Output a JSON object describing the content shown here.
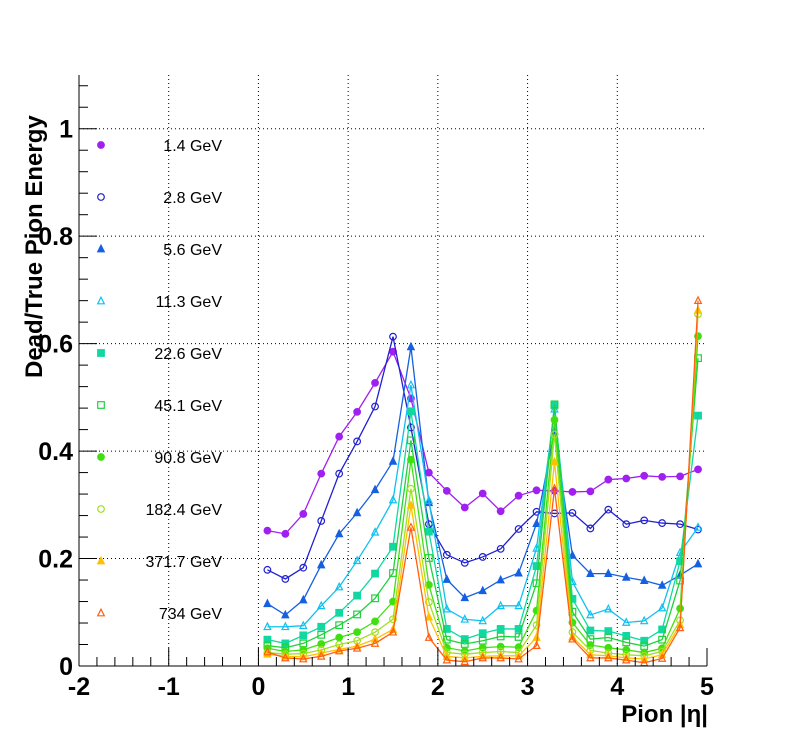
{
  "chart_data": {
    "type": "line",
    "xlabel": "Pion |η|",
    "ylabel": "Dead/True Pion Energy",
    "xlim": [
      -2,
      5
    ],
    "ylim": [
      0,
      1.1
    ],
    "x_ticks": [
      "-2",
      "-1",
      "0",
      "1",
      "2",
      "3",
      "4",
      "5"
    ],
    "y_ticks": [
      "0",
      "0.2",
      "0.4",
      "0.6",
      "0.8",
      "1"
    ],
    "grid": true,
    "legend_position": "left",
    "x": [
      0.1,
      0.3,
      0.5,
      0.7,
      0.9,
      1.1,
      1.3,
      1.5,
      1.7,
      1.9,
      2.1,
      2.3,
      2.5,
      2.7,
      2.9,
      3.1,
      3.3,
      3.5,
      3.7,
      3.9,
      4.1,
      4.3,
      4.5,
      4.7,
      4.9
    ],
    "series": [
      {
        "name": "1.4 GeV",
        "color": "#a020f0",
        "marker": "circle",
        "filled": true,
        "values": [
          0.252,
          0.246,
          0.283,
          0.358,
          0.427,
          0.473,
          0.527,
          0.585,
          0.498,
          0.36,
          0.326,
          0.295,
          0.321,
          0.288,
          0.317,
          0.327,
          0.326,
          0.324,
          0.325,
          0.347,
          0.349,
          0.354,
          0.352,
          0.353,
          0.366
        ]
      },
      {
        "name": "2.8 GeV",
        "color": "#2020d0",
        "marker": "circle",
        "filled": false,
        "values": [
          0.179,
          0.162,
          0.183,
          0.27,
          0.358,
          0.418,
          0.483,
          0.613,
          0.444,
          0.264,
          0.207,
          0.192,
          0.203,
          0.218,
          0.255,
          0.287,
          0.284,
          0.285,
          0.256,
          0.291,
          0.264,
          0.271,
          0.266,
          0.264,
          0.254
        ]
      },
      {
        "name": "5.6 GeV",
        "color": "#1560e0",
        "marker": "triangle",
        "filled": true,
        "values": [
          0.116,
          0.095,
          0.123,
          0.188,
          0.246,
          0.285,
          0.328,
          0.381,
          0.594,
          0.304,
          0.161,
          0.127,
          0.14,
          0.16,
          0.173,
          0.265,
          0.437,
          0.206,
          0.172,
          0.172,
          0.165,
          0.159,
          0.15,
          0.169,
          0.19
        ]
      },
      {
        "name": "11.3 GeV",
        "color": "#10c0f0",
        "marker": "triangle",
        "filled": false,
        "values": [
          0.073,
          0.073,
          0.075,
          0.112,
          0.147,
          0.196,
          0.249,
          0.309,
          0.523,
          0.308,
          0.106,
          0.087,
          0.084,
          0.112,
          0.112,
          0.219,
          0.478,
          0.157,
          0.095,
          0.106,
          0.081,
          0.084,
          0.108,
          0.211,
          0.258
        ]
      },
      {
        "name": "22.6 GeV",
        "color": "#10d8a0",
        "marker": "square",
        "filled": true,
        "values": [
          0.049,
          0.042,
          0.057,
          0.073,
          0.099,
          0.131,
          0.172,
          0.222,
          0.474,
          0.25,
          0.069,
          0.05,
          0.061,
          0.069,
          0.069,
          0.186,
          0.485,
          0.125,
          0.066,
          0.065,
          0.056,
          0.047,
          0.068,
          0.195,
          0.466
        ]
      },
      {
        "name": "45.1 GeV",
        "color": "#20d040",
        "marker": "square",
        "filled": false,
        "values": [
          0.038,
          0.034,
          0.042,
          0.058,
          0.076,
          0.096,
          0.126,
          0.173,
          0.42,
          0.201,
          0.049,
          0.041,
          0.047,
          0.055,
          0.054,
          0.154,
          0.487,
          0.101,
          0.05,
          0.053,
          0.044,
          0.037,
          0.049,
          0.159,
          0.573
        ]
      },
      {
        "name": "90.8 GeV",
        "color": "#40e010",
        "marker": "circle",
        "filled": true,
        "values": [
          0.033,
          0.027,
          0.03,
          0.041,
          0.053,
          0.063,
          0.083,
          0.12,
          0.384,
          0.151,
          0.034,
          0.028,
          0.034,
          0.036,
          0.035,
          0.103,
          0.458,
          0.081,
          0.039,
          0.034,
          0.03,
          0.025,
          0.033,
          0.107,
          0.614
        ]
      },
      {
        "name": "182.4 GeV",
        "color": "#a0e020",
        "marker": "circle",
        "filled": false,
        "values": [
          0.025,
          0.022,
          0.023,
          0.03,
          0.04,
          0.047,
          0.063,
          0.087,
          0.33,
          0.119,
          0.025,
          0.022,
          0.025,
          0.027,
          0.025,
          0.076,
          0.431,
          0.063,
          0.029,
          0.024,
          0.021,
          0.019,
          0.027,
          0.085,
          0.655
        ]
      },
      {
        "name": "371.7 GeV",
        "color": "#ffc000",
        "marker": "triangle",
        "filled": true,
        "values": [
          0.022,
          0.018,
          0.017,
          0.024,
          0.031,
          0.037,
          0.05,
          0.068,
          0.299,
          0.091,
          0.018,
          0.015,
          0.018,
          0.019,
          0.019,
          0.053,
          0.38,
          0.054,
          0.021,
          0.019,
          0.015,
          0.013,
          0.021,
          0.077,
          0.662
        ]
      },
      {
        "name": "734 GeV",
        "color": "#ff6010",
        "marker": "triangle",
        "filled": false,
        "values": [
          0.026,
          0.015,
          0.013,
          0.018,
          0.028,
          0.033,
          0.042,
          0.063,
          0.258,
          0.053,
          0.011,
          0.008,
          0.015,
          0.015,
          0.013,
          0.038,
          0.33,
          0.05,
          0.015,
          0.015,
          0.011,
          0.006,
          0.014,
          0.071,
          0.68
        ]
      }
    ]
  }
}
